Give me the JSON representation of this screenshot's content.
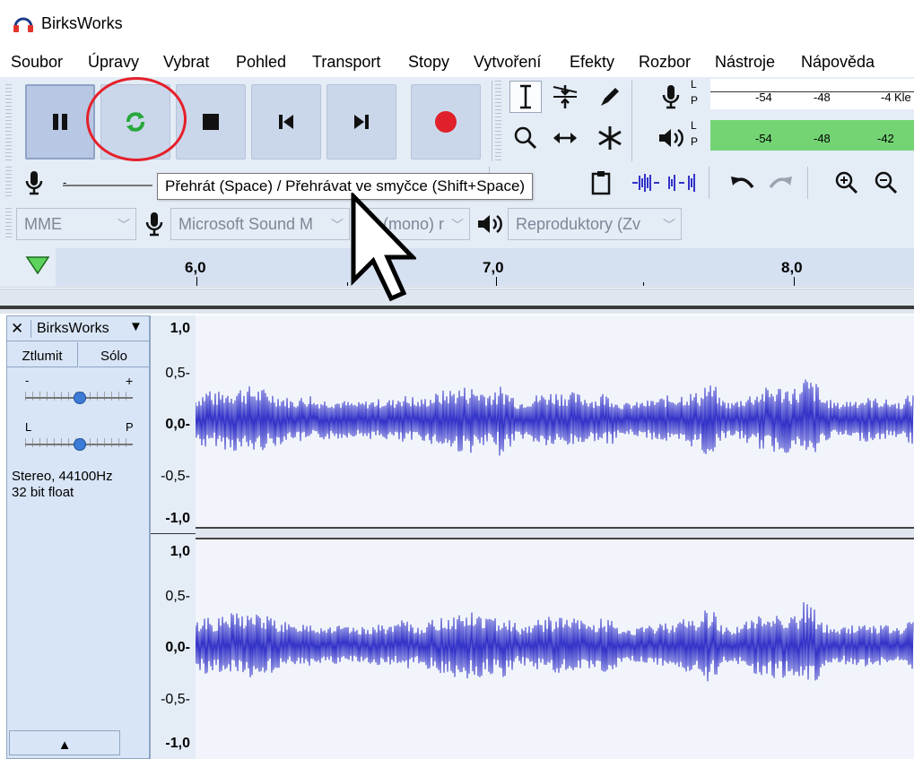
{
  "window": {
    "title": "BirksWorks"
  },
  "menu": [
    "Soubor",
    "Úpravy",
    "Vybrat",
    "Pohled",
    "Transport",
    "Stopy",
    "Vytvoření",
    "Efekty",
    "Rozbor",
    "Nástroje",
    "Nápověda"
  ],
  "meters": {
    "record": {
      "l": "L",
      "p": "P",
      "ticks": [
        "-54",
        "-48",
        "-4"
      ],
      "hint": "Kle"
    },
    "play": {
      "l": "L",
      "p": "P",
      "ticks": [
        "-54",
        "-48",
        "-42"
      ]
    }
  },
  "tooltip": "Přehrát (Space) / Přehrávat ve smyčce (Shift+Space)",
  "devices": {
    "host": "MME",
    "input": "Microsoft Sound M",
    "channels": "(mono) r",
    "output": "Reproduktory (Zv"
  },
  "ruler": {
    "labels": [
      "6,0",
      "7,0",
      "8,0"
    ]
  },
  "track": {
    "name": "BirksWorks",
    "mute_label": "Ztlumit",
    "solo_label": "Sólo",
    "gain_minus": "-",
    "gain_plus": "+",
    "pan_left": "L",
    "pan_right": "P",
    "format_line1": "Stereo, 44100Hz",
    "format_line2": "32 bit float",
    "gain_level": 0.5,
    "pan_level": 0.5
  },
  "vruler": {
    "top": [
      "1,0",
      "0,5-",
      "0,0-",
      "-0,5-",
      "-1,0"
    ],
    "bottom": [
      "1,0",
      "0,5-",
      "0,0-",
      "-0,5-",
      "-1,0"
    ]
  },
  "colors": {
    "wave": "#3232c8",
    "meter_green": "#74d474",
    "accent_circle": "#e5202a"
  }
}
